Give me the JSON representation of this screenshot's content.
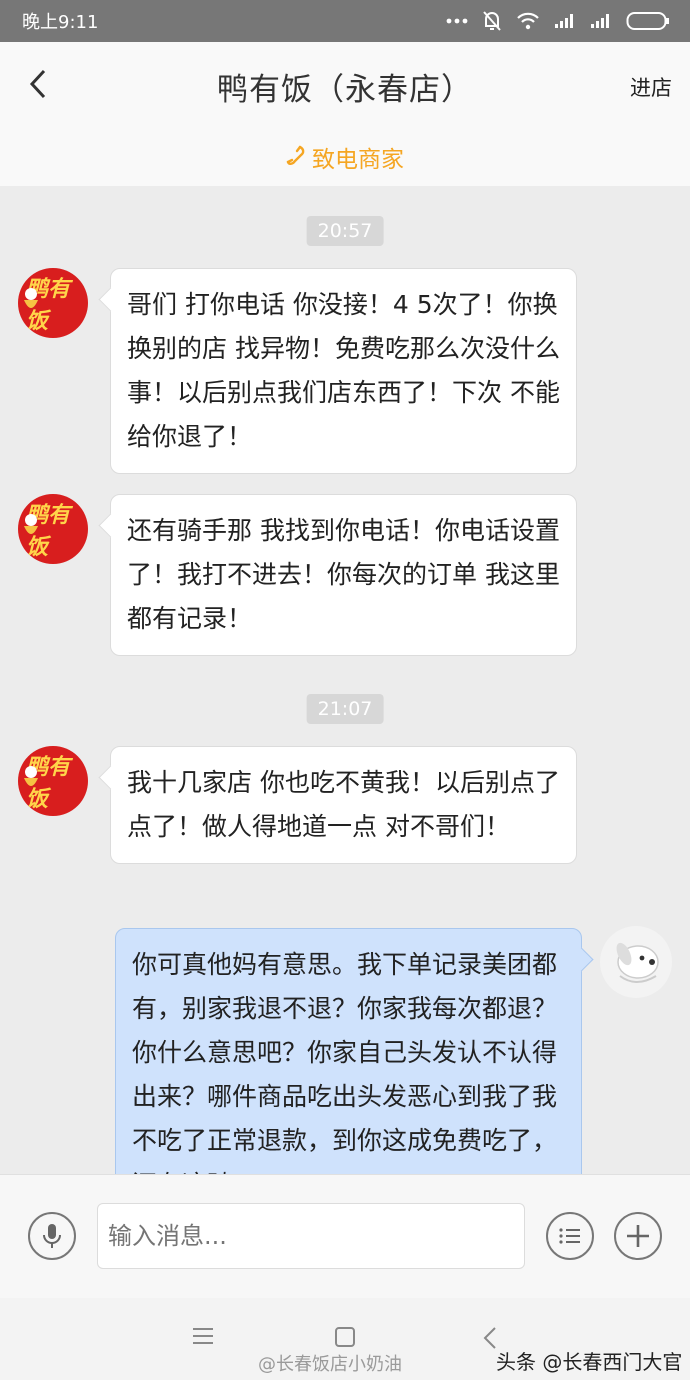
{
  "status_bar": {
    "time": "晚上9:11"
  },
  "header": {
    "title": "鸭有饭（永春店）",
    "right_action": "进店",
    "call_label": "致电商家"
  },
  "chat": {
    "timestamps": [
      "20:57",
      "21:07"
    ],
    "merchant_avatar_text": "鸭有饭",
    "messages": [
      {
        "from": "merchant",
        "text": "哥们 打你电话 你没接！4 5次了！你换换别的店 找异物！免费吃那么次没什么事！以后别点我们店东西了！下次 不能给你退了！"
      },
      {
        "from": "merchant",
        "text": "还有骑手那 我找到你电话！你电话设置了！我打不进去！你每次的订单 我这里都有记录！"
      },
      {
        "from": "merchant",
        "text": "我十几家店 你也吃不黄我！以后别点了 点了！做人得地道一点 对不哥们！"
      },
      {
        "from": "user",
        "text": "你可真他妈有意思。我下单记录美团都有，别家我退不退？你家我每次都退？你什么意思吧？你家自己头发认不认得出来？哪件商品吃出头发恶心到我了我不吃了正常退款，到你这成免费吃了，还有这骑"
      }
    ]
  },
  "input_bar": {
    "placeholder": "输入消息..."
  },
  "watermarks": {
    "weibo": "@长春饭店小奶油",
    "toutiao": "头条 @长春西门大官人"
  },
  "colors": {
    "accent": "#f5a623",
    "self_bubble": "#cfe2fc",
    "merchant_avatar": "#d81e1e"
  }
}
